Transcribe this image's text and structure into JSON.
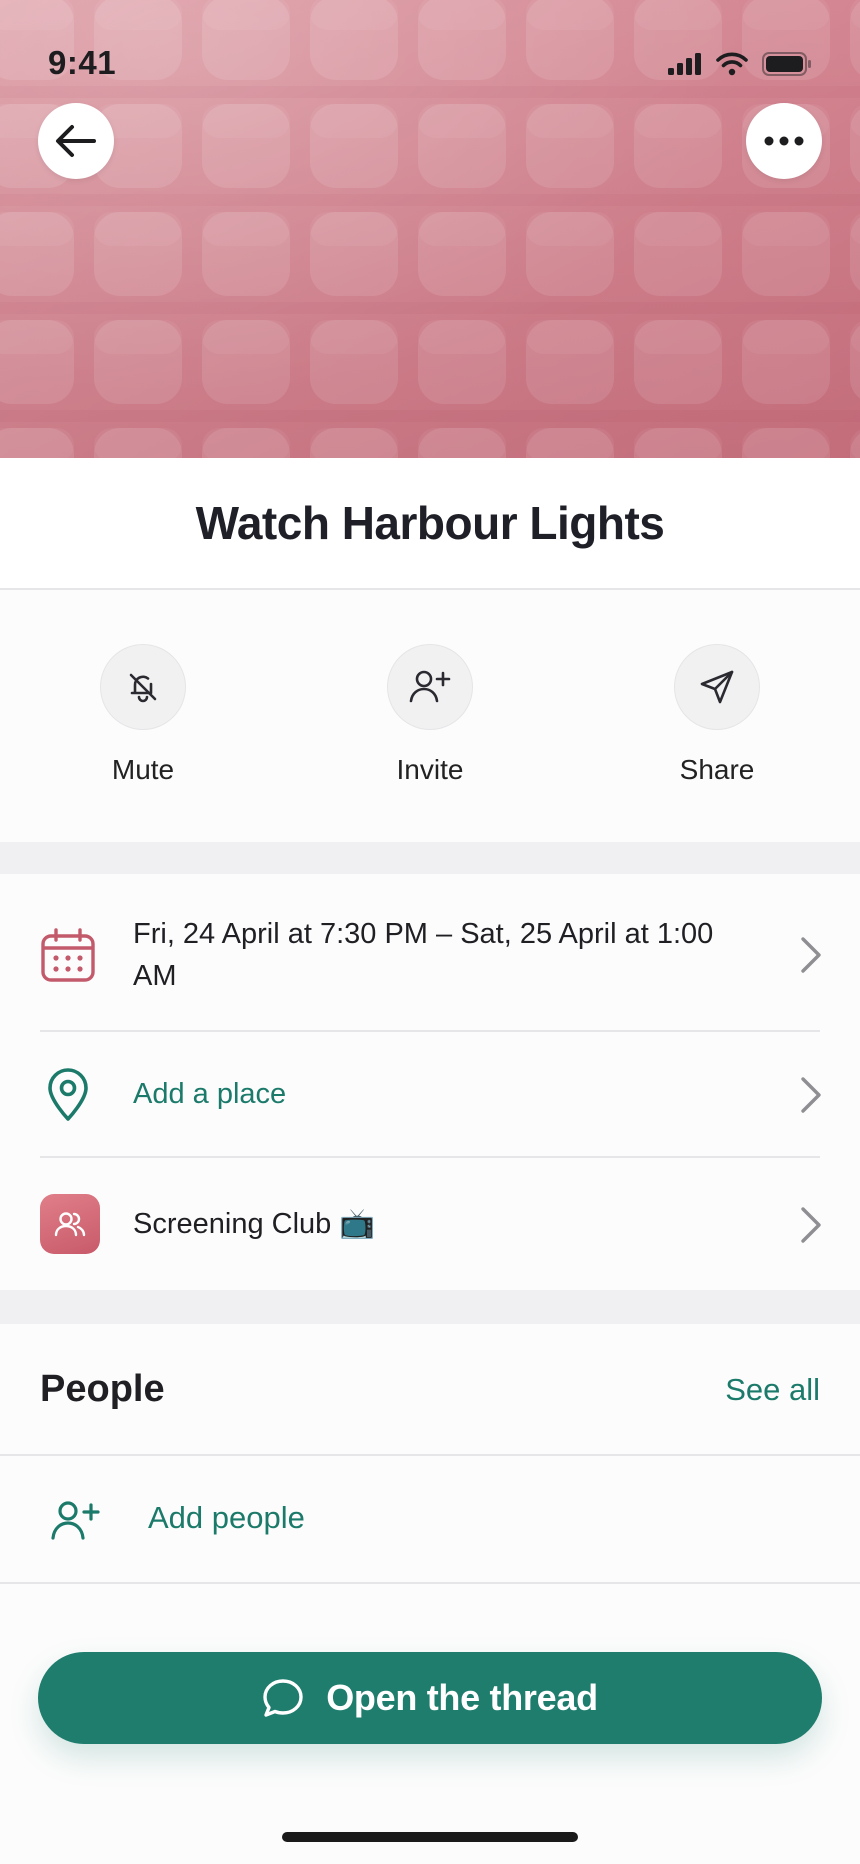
{
  "status_bar": {
    "time": "9:41"
  },
  "event": {
    "title": "Watch Harbour Lights"
  },
  "actions": [
    {
      "label": "Mute",
      "icon": "bell-off-icon"
    },
    {
      "label": "Invite",
      "icon": "user-plus-icon"
    },
    {
      "label": "Share",
      "icon": "send-icon"
    }
  ],
  "details": {
    "datetime_line1": "Fri, 24 April at 7:30 PM – Sat, 25 April at 1:00",
    "datetime_line2": "AM",
    "place": "Add a place",
    "group": "Screening Club 📺"
  },
  "people": {
    "title": "People",
    "see_all": "See all",
    "add_people": "Add people"
  },
  "cta": {
    "label": "Open the thread"
  },
  "colors": {
    "cover": "#d27c88",
    "accent_green": "#1e7d6d",
    "calendar_red": "#c25a6b"
  }
}
